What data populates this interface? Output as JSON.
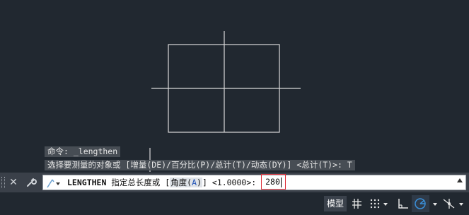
{
  "history": {
    "line1": "命令: _lengthen",
    "line2": "选择要测量的对象或 [增量(DE)/百分比(P)/总计(T)/动态(DY)] <总计(T)>: T"
  },
  "command": {
    "keyword": "LENGTHEN",
    "prompt_before": " 指定总长度或 ",
    "option_open": "[",
    "option_label": "角度(",
    "option_key": "A",
    "option_close_paren": ")",
    "option_close": "]",
    "default_value": " <1.0000>: ",
    "entered_value": "280"
  },
  "status": {
    "model_label": "模型"
  },
  "icons": {
    "close": "close-icon",
    "customize": "wrench-icon",
    "prompt": "command-line-icon",
    "grid": "grid-icon",
    "snap": "snap-icon",
    "ortho": "ortho-icon",
    "polar": "polar-tracking-icon",
    "osnap": "object-snap-icon"
  },
  "colors": {
    "background": "#212830",
    "drawing_lines": "#d9d9d9",
    "highlight_border": "#e0303a",
    "polar_active": "#3a8fd8"
  }
}
